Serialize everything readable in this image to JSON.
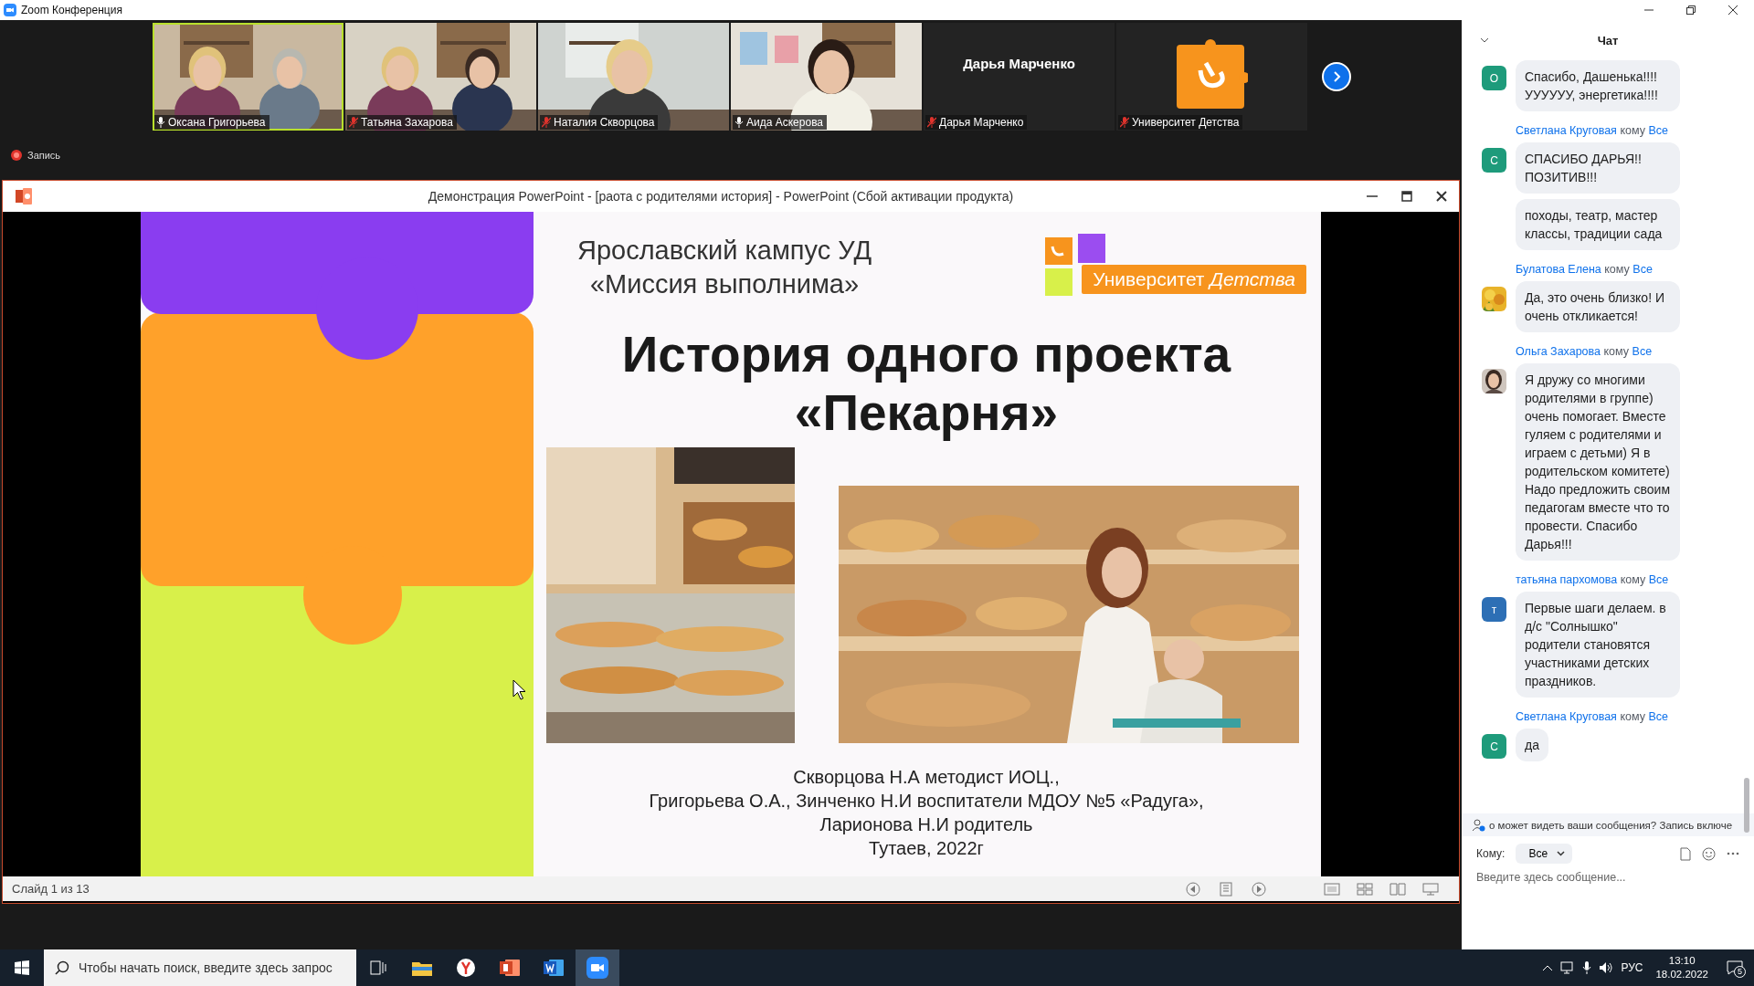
{
  "window": {
    "title": "Zoom Конференция"
  },
  "participants": [
    {
      "name": "Оксана Григорьева",
      "kind": "video",
      "muted": false,
      "speaking": true
    },
    {
      "name": "Татьяна Захарова",
      "kind": "video",
      "muted": true,
      "speaking": false
    },
    {
      "name": "Наталия Скворцова",
      "kind": "video",
      "muted": true,
      "speaking": false
    },
    {
      "name": "Аида Аскерова",
      "kind": "video",
      "muted": false,
      "speaking": false
    },
    {
      "name": "Дарья Марченко",
      "kind": "name",
      "display_name": "Дарья Марченко",
      "muted": true,
      "speaking": false
    },
    {
      "name": "Университет Детства",
      "kind": "logo",
      "muted": true,
      "speaking": false
    }
  ],
  "recording": {
    "label": "Запись"
  },
  "powerpoint": {
    "title": "Демонстрация PowerPoint - [раота с родителями история] - PowerPoint (Сбой активации продукта)",
    "status": "Слайд 1 из 13"
  },
  "slide": {
    "campus": [
      "Ярославский кампус УД",
      "«Миссия выполнима»"
    ],
    "logo_text": "Университет *Детства*",
    "title": [
      "История одного проекта",
      "«Пекарня»"
    ],
    "credits": [
      "Скворцова Н.А методист ИОЦ.,",
      "Григорьева О.А., Зинченко Н.И воспитатели МДОУ №5 «Радуга»,",
      "Ларионова  Н.И родитель",
      "Тутаев, 2022г"
    ]
  },
  "chat": {
    "title": "Чат",
    "groups": [
      {
        "avatar": {
          "kind": "letter",
          "letter": "О",
          "color": "#1e9b7b"
        },
        "bubbles": [
          "Спасибо, Дашенька!!!! УУУУУУ, энергетика!!!!"
        ]
      },
      {
        "sender": "Светлана Круговая",
        "to": "кому",
        "target": "Все",
        "avatar": {
          "kind": "letter",
          "letter": "С",
          "color": "#1e9b7b"
        },
        "bubbles": [
          "СПАСИБО ДАРЬЯ!! ПОЗИТИВ!!!",
          "походы, театр, мастер классы, традиции сада"
        ]
      },
      {
        "sender": "Булатова Елена",
        "to": "кому",
        "target": "Все",
        "avatar": {
          "kind": "flowers"
        },
        "bubbles": [
          "Да, это очень близко! И очень откликается!"
        ]
      },
      {
        "sender": "Ольга Захарова",
        "to": "кому",
        "target": "Все",
        "avatar": {
          "kind": "person"
        },
        "bubbles": [
          "Я дружу со многими родителями в группе) очень помогает. Вместе гуляем с родителями и играем с детьми) Я в родительском комитете) Надо предложить своим педагогам вместе что то провести. Спасибо Дарья!!!"
        ]
      },
      {
        "sender": "татьяна пархомова",
        "to": "кому",
        "target": "Все",
        "avatar": {
          "kind": "letter",
          "letter": "т",
          "color": "#2d6fb5"
        },
        "bubbles": [
          "Первые шаги делаем. в д/с \"Солнышко\" родители становятся участниками детских праздников."
        ]
      },
      {
        "sender": "Светлана Круговая",
        "to": "кому",
        "target": "Все",
        "avatar": {
          "kind": "letter",
          "letter": "С",
          "color": "#1e9b7b"
        },
        "bubbles": [
          "да"
        ]
      }
    ],
    "notice": "о может видеть ваши сообщения? Запись включе",
    "to_label": "Кому:",
    "to_value": "Все",
    "placeholder": "Введите здесь сообщение..."
  },
  "taskbar": {
    "search_placeholder": "Чтобы начать поиск, введите здесь запрос",
    "language": "РУС",
    "time": "13:10",
    "date": "18.02.2022",
    "notifications": "5"
  }
}
